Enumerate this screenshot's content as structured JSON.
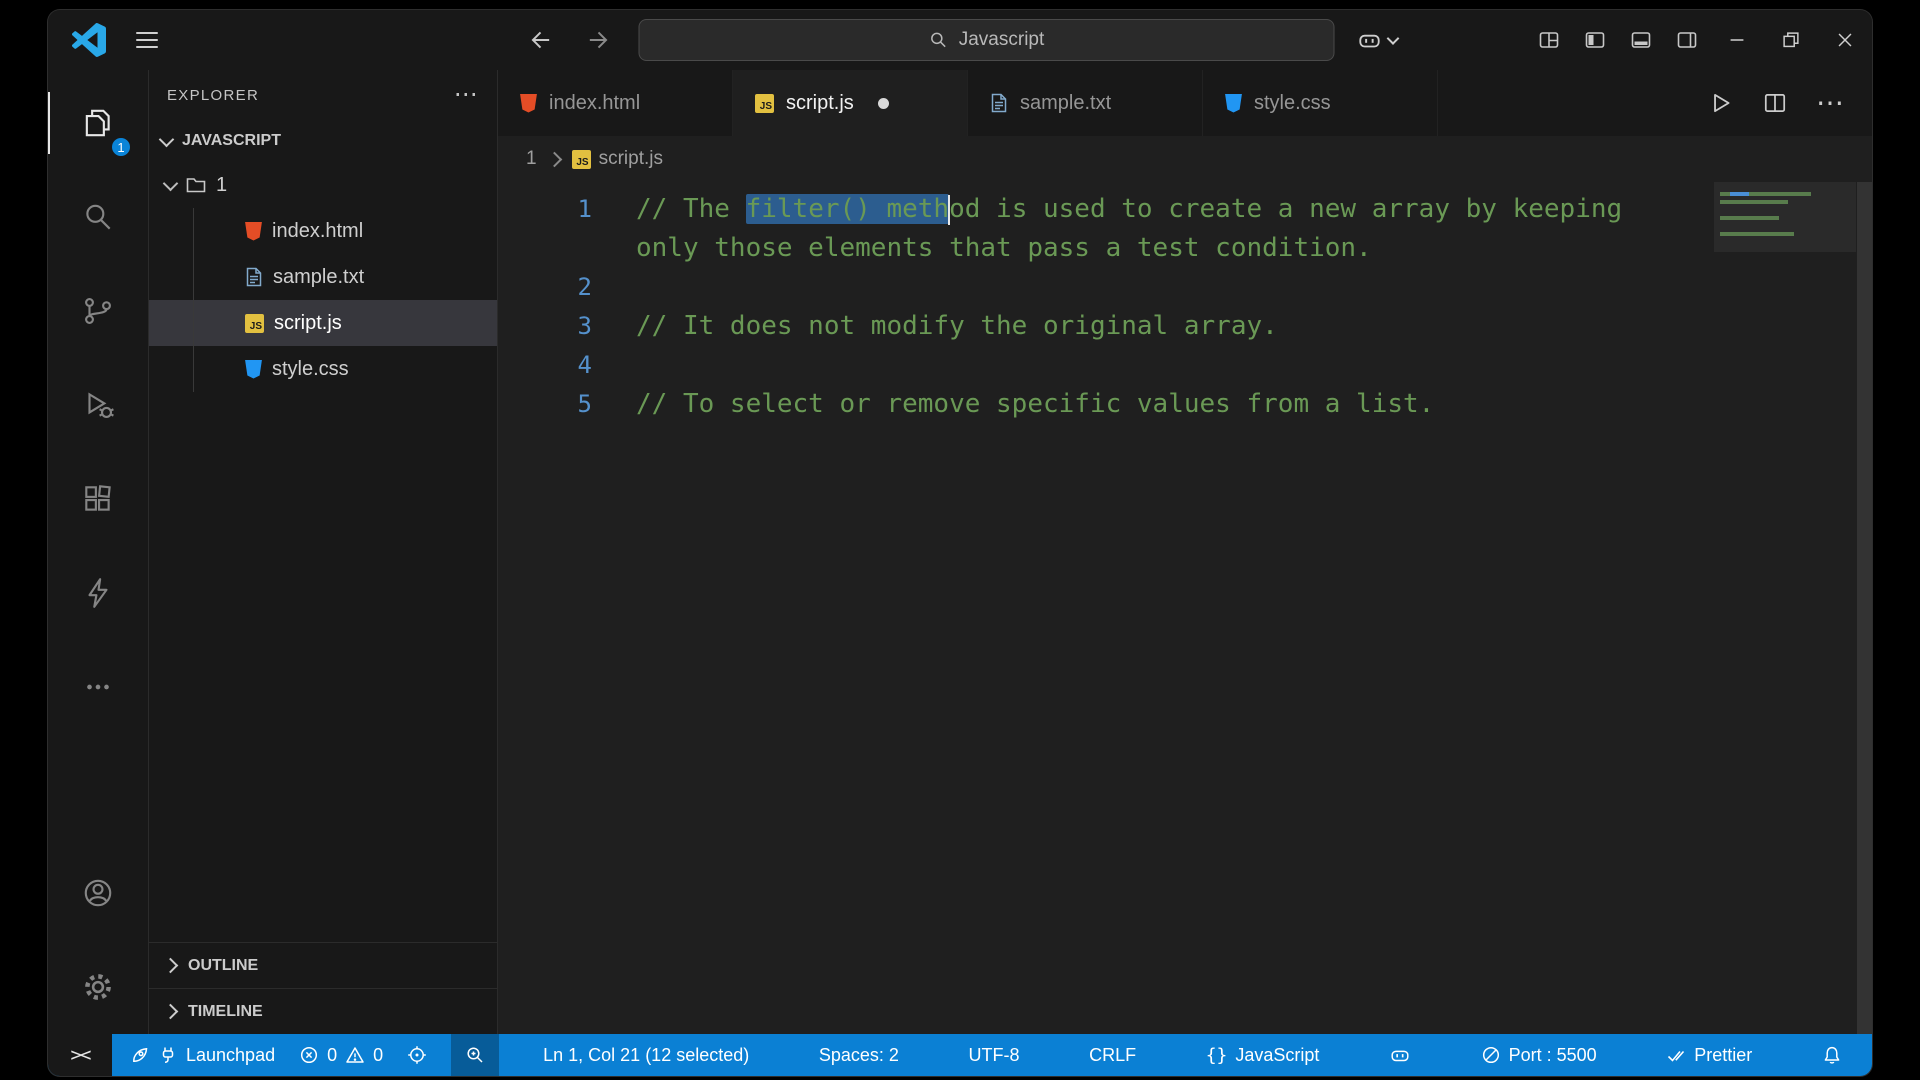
{
  "title_bar": {
    "command_center": "Javascript"
  },
  "activity_bar": {
    "explorer_badge": "1"
  },
  "explorer": {
    "title": "EXPLORER",
    "workspace": "JAVASCRIPT",
    "tree": [
      {
        "label": "1",
        "type": "folder",
        "level": 0,
        "expanded": true
      },
      {
        "label": "index.html",
        "type": "html",
        "level": 1
      },
      {
        "label": "sample.txt",
        "type": "txt",
        "level": 1
      },
      {
        "label": "script.js",
        "type": "js",
        "level": 1,
        "selected": true
      },
      {
        "label": "style.css",
        "type": "css",
        "level": 1
      }
    ],
    "panels": [
      "OUTLINE",
      "TIMELINE"
    ]
  },
  "editor_tabs": [
    {
      "label": "index.html",
      "icon": "html",
      "active": false,
      "dirty": false
    },
    {
      "label": "script.js",
      "icon": "js",
      "active": true,
      "dirty": true
    },
    {
      "label": "sample.txt",
      "icon": "txt",
      "active": false,
      "dirty": false
    },
    {
      "label": "style.css",
      "icon": "css",
      "active": false,
      "dirty": false
    }
  ],
  "breadcrumb": [
    {
      "label": "1"
    },
    {
      "label": "script.js",
      "icon": "js"
    }
  ],
  "editor": {
    "lines": [
      {
        "num": "1",
        "parts": [
          {
            "text": "// The "
          },
          {
            "text": "filter() meth",
            "selected": true,
            "caret_after": true
          },
          {
            "text": "od is used to create a new array by keeping"
          }
        ]
      },
      {
        "num": "",
        "parts": [
          {
            "text": "only those elements that pass a test condition."
          }
        ]
      },
      {
        "num": "2",
        "parts": []
      },
      {
        "num": "3",
        "parts": [
          {
            "text": "// It does not modify the original array."
          }
        ]
      },
      {
        "num": "4",
        "parts": []
      },
      {
        "num": "5",
        "parts": [
          {
            "text": "// To select or remove specific values from a list."
          }
        ]
      }
    ]
  },
  "status_bar": {
    "remote": "><",
    "launchpad": "Launchpad",
    "errors": "0",
    "warnings": "0",
    "cursor_position": "Ln 1, Col 21 (12 selected)",
    "indentation": "Spaces: 2",
    "encoding": "UTF-8",
    "eol": "CRLF",
    "language_braces": "{}",
    "language": "JavaScript",
    "port": "Port : 5500",
    "formatter": "Prettier"
  },
  "icons": {
    "vscode-logo": "blue code mark",
    "menu": "hamburger",
    "back": "arrow-left",
    "forward": "arrow-right",
    "search": "magnifier",
    "copilot": "robot-face",
    "chevron-down": "chevron",
    "customize-layout": "grid-square",
    "toggle-primary-sidebar": "square-left-filled",
    "toggle-panel": "square-bottom-filled",
    "toggle-secondary-sidebar": "square-right-line",
    "minimize": "dash",
    "restore": "overlapping-squares",
    "close": "x",
    "explorer": "stacked-files",
    "search-view": "magnifier",
    "source-control": "git-branch",
    "run-debug": "play-with-bug",
    "extensions": "squares",
    "thunder-client": "lightning-bolt",
    "more-views": "ellipsis",
    "account": "person-circle",
    "settings": "gear",
    "run-file": "play-outline",
    "split-editor": "split-square",
    "remote": "greater-less",
    "launchpad": "rocket-and-plug",
    "problems-error": "circle-cross",
    "problems-warning": "warning-triangle",
    "focus-target": "crosshair-circle",
    "zoom-indicator": "magnifier-plus",
    "port-status": "circle-slash",
    "prettier": "double-check",
    "notifications": "bell"
  },
  "colors": {
    "statusbar": "#0b80d4",
    "accent": "#0a84d8",
    "comment": "#6a9955",
    "selection": "#2c5d8f",
    "lineno": "#5591cc"
  }
}
